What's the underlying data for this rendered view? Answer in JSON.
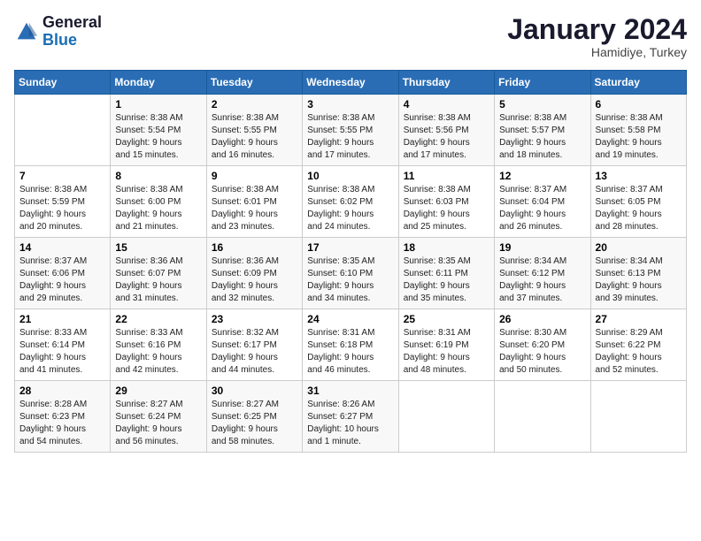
{
  "header": {
    "logo_line1": "General",
    "logo_line2": "Blue",
    "month": "January 2024",
    "location": "Hamidiye, Turkey"
  },
  "days_of_week": [
    "Sunday",
    "Monday",
    "Tuesday",
    "Wednesday",
    "Thursday",
    "Friday",
    "Saturday"
  ],
  "weeks": [
    [
      {
        "day": "",
        "text": ""
      },
      {
        "day": "1",
        "text": "Sunrise: 8:38 AM\nSunset: 5:54 PM\nDaylight: 9 hours\nand 15 minutes."
      },
      {
        "day": "2",
        "text": "Sunrise: 8:38 AM\nSunset: 5:55 PM\nDaylight: 9 hours\nand 16 minutes."
      },
      {
        "day": "3",
        "text": "Sunrise: 8:38 AM\nSunset: 5:55 PM\nDaylight: 9 hours\nand 17 minutes."
      },
      {
        "day": "4",
        "text": "Sunrise: 8:38 AM\nSunset: 5:56 PM\nDaylight: 9 hours\nand 17 minutes."
      },
      {
        "day": "5",
        "text": "Sunrise: 8:38 AM\nSunset: 5:57 PM\nDaylight: 9 hours\nand 18 minutes."
      },
      {
        "day": "6",
        "text": "Sunrise: 8:38 AM\nSunset: 5:58 PM\nDaylight: 9 hours\nand 19 minutes."
      }
    ],
    [
      {
        "day": "7",
        "text": "Sunrise: 8:38 AM\nSunset: 5:59 PM\nDaylight: 9 hours\nand 20 minutes."
      },
      {
        "day": "8",
        "text": "Sunrise: 8:38 AM\nSunset: 6:00 PM\nDaylight: 9 hours\nand 21 minutes."
      },
      {
        "day": "9",
        "text": "Sunrise: 8:38 AM\nSunset: 6:01 PM\nDaylight: 9 hours\nand 23 minutes."
      },
      {
        "day": "10",
        "text": "Sunrise: 8:38 AM\nSunset: 6:02 PM\nDaylight: 9 hours\nand 24 minutes."
      },
      {
        "day": "11",
        "text": "Sunrise: 8:38 AM\nSunset: 6:03 PM\nDaylight: 9 hours\nand 25 minutes."
      },
      {
        "day": "12",
        "text": "Sunrise: 8:37 AM\nSunset: 6:04 PM\nDaylight: 9 hours\nand 26 minutes."
      },
      {
        "day": "13",
        "text": "Sunrise: 8:37 AM\nSunset: 6:05 PM\nDaylight: 9 hours\nand 28 minutes."
      }
    ],
    [
      {
        "day": "14",
        "text": "Sunrise: 8:37 AM\nSunset: 6:06 PM\nDaylight: 9 hours\nand 29 minutes."
      },
      {
        "day": "15",
        "text": "Sunrise: 8:36 AM\nSunset: 6:07 PM\nDaylight: 9 hours\nand 31 minutes."
      },
      {
        "day": "16",
        "text": "Sunrise: 8:36 AM\nSunset: 6:09 PM\nDaylight: 9 hours\nand 32 minutes."
      },
      {
        "day": "17",
        "text": "Sunrise: 8:35 AM\nSunset: 6:10 PM\nDaylight: 9 hours\nand 34 minutes."
      },
      {
        "day": "18",
        "text": "Sunrise: 8:35 AM\nSunset: 6:11 PM\nDaylight: 9 hours\nand 35 minutes."
      },
      {
        "day": "19",
        "text": "Sunrise: 8:34 AM\nSunset: 6:12 PM\nDaylight: 9 hours\nand 37 minutes."
      },
      {
        "day": "20",
        "text": "Sunrise: 8:34 AM\nSunset: 6:13 PM\nDaylight: 9 hours\nand 39 minutes."
      }
    ],
    [
      {
        "day": "21",
        "text": "Sunrise: 8:33 AM\nSunset: 6:14 PM\nDaylight: 9 hours\nand 41 minutes."
      },
      {
        "day": "22",
        "text": "Sunrise: 8:33 AM\nSunset: 6:16 PM\nDaylight: 9 hours\nand 42 minutes."
      },
      {
        "day": "23",
        "text": "Sunrise: 8:32 AM\nSunset: 6:17 PM\nDaylight: 9 hours\nand 44 minutes."
      },
      {
        "day": "24",
        "text": "Sunrise: 8:31 AM\nSunset: 6:18 PM\nDaylight: 9 hours\nand 46 minutes."
      },
      {
        "day": "25",
        "text": "Sunrise: 8:31 AM\nSunset: 6:19 PM\nDaylight: 9 hours\nand 48 minutes."
      },
      {
        "day": "26",
        "text": "Sunrise: 8:30 AM\nSunset: 6:20 PM\nDaylight: 9 hours\nand 50 minutes."
      },
      {
        "day": "27",
        "text": "Sunrise: 8:29 AM\nSunset: 6:22 PM\nDaylight: 9 hours\nand 52 minutes."
      }
    ],
    [
      {
        "day": "28",
        "text": "Sunrise: 8:28 AM\nSunset: 6:23 PM\nDaylight: 9 hours\nand 54 minutes."
      },
      {
        "day": "29",
        "text": "Sunrise: 8:27 AM\nSunset: 6:24 PM\nDaylight: 9 hours\nand 56 minutes."
      },
      {
        "day": "30",
        "text": "Sunrise: 8:27 AM\nSunset: 6:25 PM\nDaylight: 9 hours\nand 58 minutes."
      },
      {
        "day": "31",
        "text": "Sunrise: 8:26 AM\nSunset: 6:27 PM\nDaylight: 10 hours\nand 1 minute."
      },
      {
        "day": "",
        "text": ""
      },
      {
        "day": "",
        "text": ""
      },
      {
        "day": "",
        "text": ""
      }
    ]
  ]
}
